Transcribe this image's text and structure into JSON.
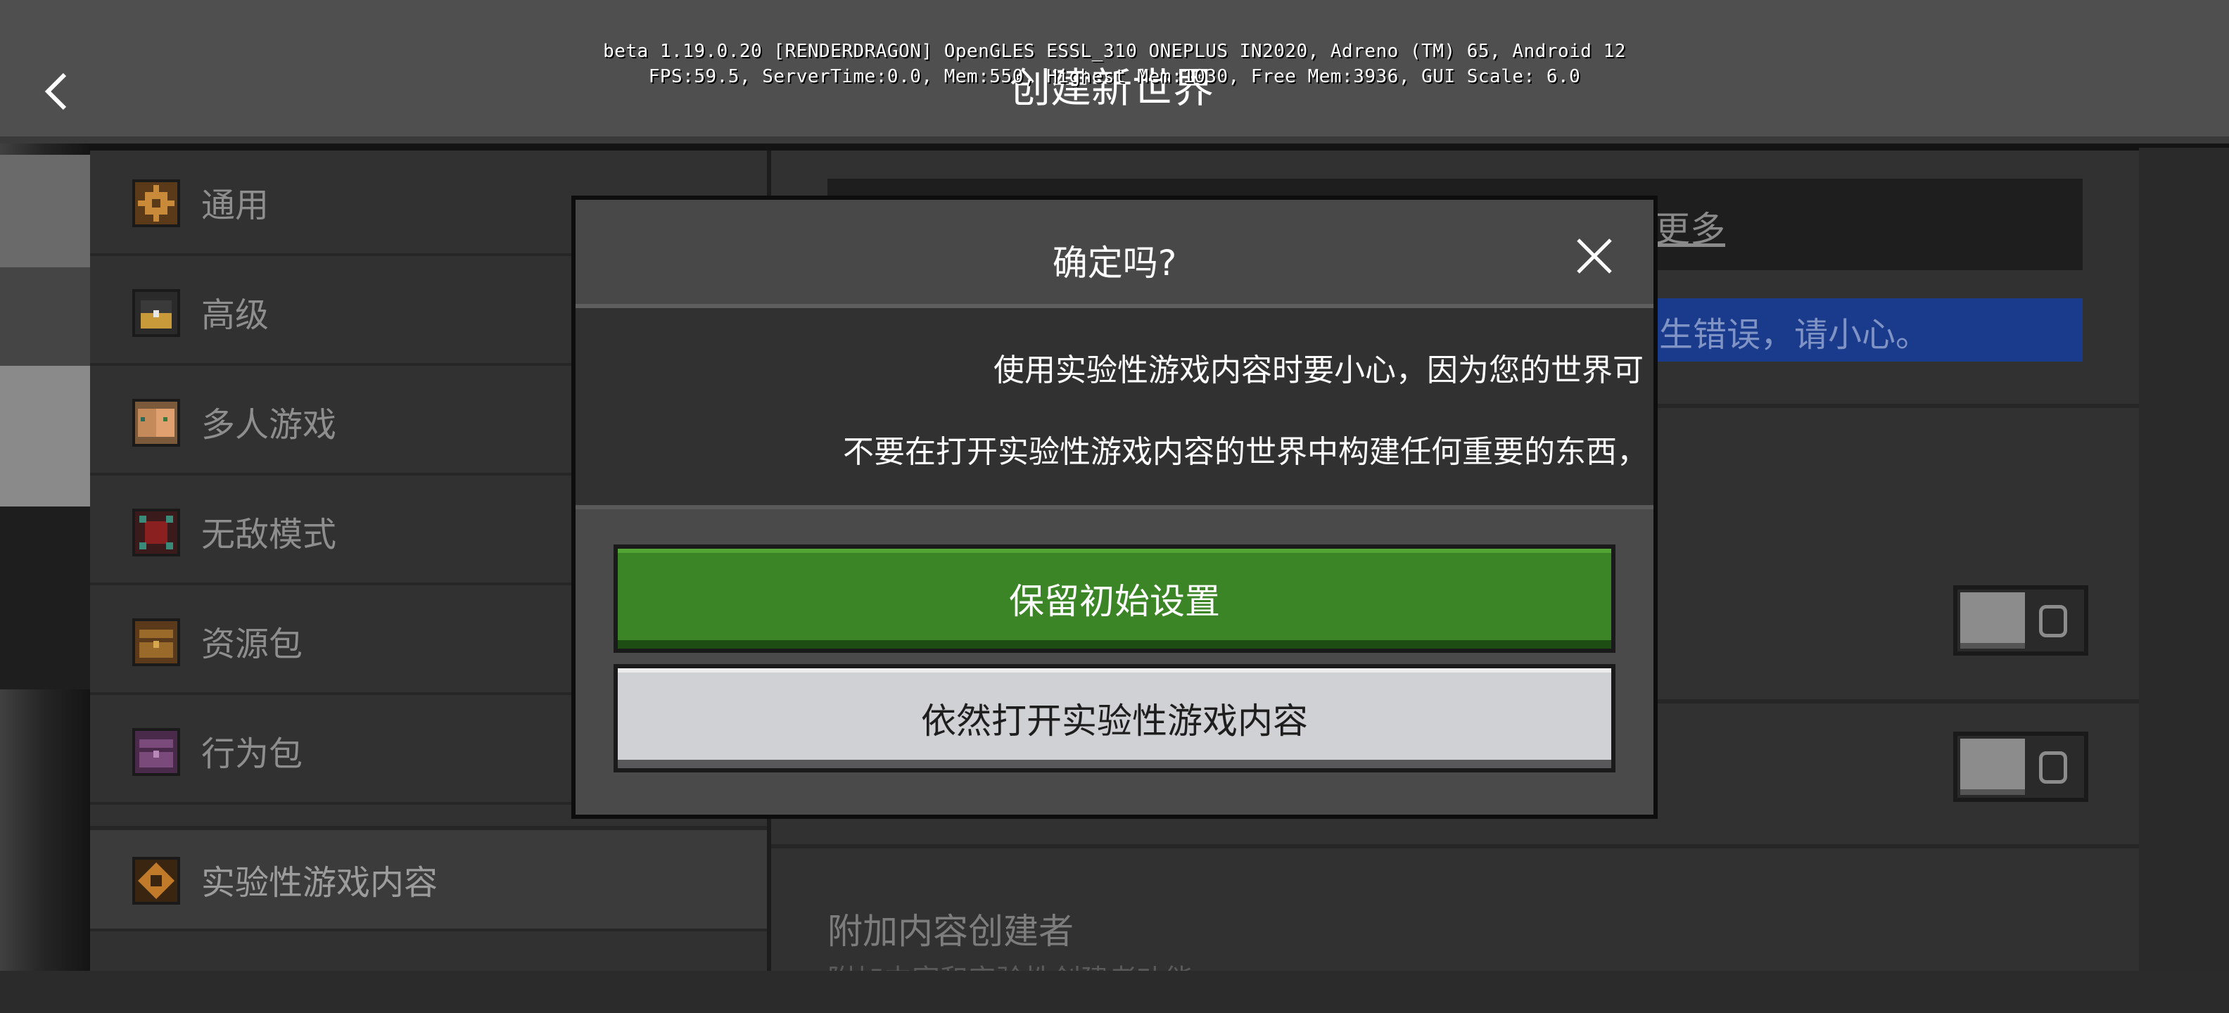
{
  "debug": {
    "line1": "beta 1.19.0.20 [RENDERDRAGON] OpenGLES ESSL_310 ONEPLUS IN2020, Adreno (TM) 65, Android 12",
    "line2": "FPS:59.5, ServerTime:0.0, Mem:550, Highest Mem:1030, Free Mem:3936, GUI Scale: 6.0"
  },
  "header": {
    "title": "创建新世界"
  },
  "sidebar": {
    "items": [
      {
        "label": "通用",
        "icon": "gear-icon"
      },
      {
        "label": "高级",
        "icon": "chest-icon"
      },
      {
        "label": "多人游戏",
        "icon": "players-icon"
      },
      {
        "label": "无敌模式",
        "icon": "cheats-icon"
      },
      {
        "label": "资源包",
        "icon": "resource-pack-icon"
      },
      {
        "label": "行为包",
        "icon": "behavior-pack-icon"
      },
      {
        "label": "实验性游戏内容",
        "icon": "experiments-icon",
        "active": true
      }
    ]
  },
  "main": {
    "more_link": "更多",
    "warning_text": "生错误，请小心。",
    "addon_title": "附加内容创建者",
    "addon_desc": "附加内容和实验性创建者功能"
  },
  "dialog": {
    "title": "确定吗?",
    "message_1": "使用实验性游戏内容时要小心，因为您的世界可",
    "message_2": "不要在打开实验性游戏内容的世界中构建任何重要的东西，",
    "keep_button": "保留初始设置",
    "proceed_button": "依然打开实验性游戏内容"
  },
  "colors": {
    "primary_button": "#3c8527",
    "secondary_button": "#d0d1d4",
    "warning_bar": "#1a3a8c"
  }
}
